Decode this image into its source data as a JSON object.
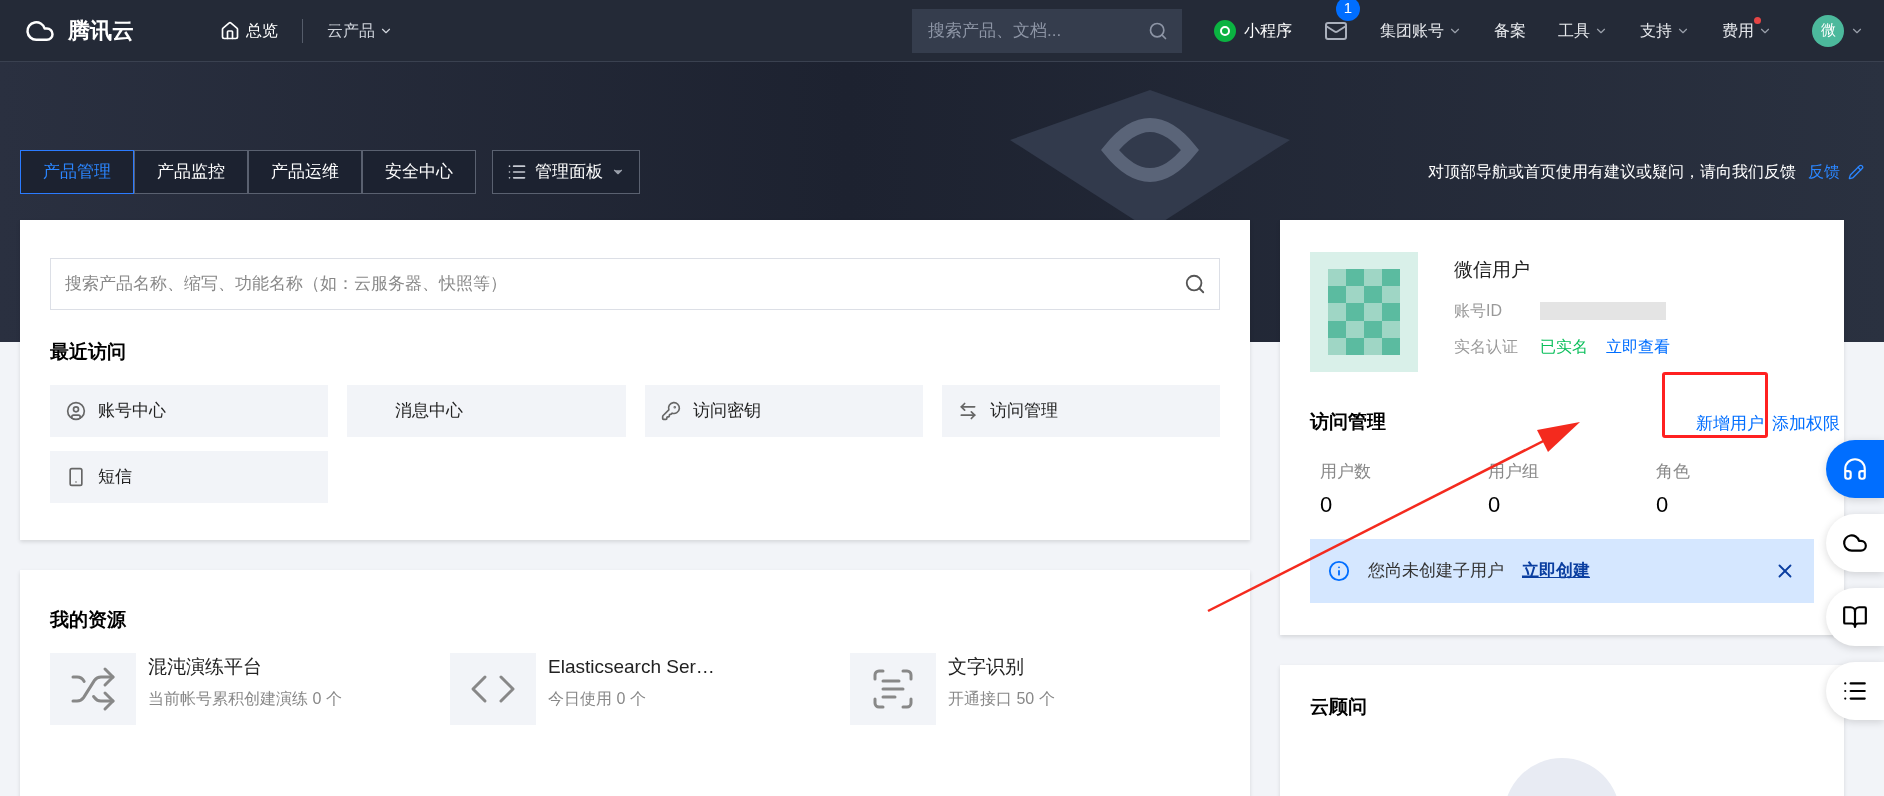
{
  "nav": {
    "logo": "腾讯云",
    "home": "总览",
    "products": "云产品",
    "search_placeholder": "搜索产品、文档...",
    "miniapp": "小程序",
    "mail_badge": "1",
    "items": [
      {
        "label": "集团账号",
        "dropdown": true,
        "dot": false
      },
      {
        "label": "备案",
        "dropdown": false,
        "dot": false
      },
      {
        "label": "工具",
        "dropdown": true,
        "dot": false
      },
      {
        "label": "支持",
        "dropdown": true,
        "dot": false
      },
      {
        "label": "费用",
        "dropdown": true,
        "dot": true
      }
    ],
    "avatar": "微"
  },
  "tabs": [
    {
      "label": "产品管理",
      "selected": true
    },
    {
      "label": "产品监控",
      "selected": false
    },
    {
      "label": "产品运维",
      "selected": false
    },
    {
      "label": "安全中心",
      "selected": false
    }
  ],
  "panel_button": "管理面板",
  "feedback": {
    "text": "对顶部导航或首页使用有建议或疑问，请向我们反馈",
    "link": "反馈"
  },
  "search": {
    "placeholder": "搜索产品名称、缩写、功能名称（如：云服务器、快照等）"
  },
  "recent": {
    "title": "最近访问",
    "items": [
      {
        "label": "账号中心",
        "kind": "user"
      },
      {
        "label": "消息中心",
        "kind": "plain"
      },
      {
        "label": "访问密钥",
        "kind": "key"
      },
      {
        "label": "访问管理",
        "kind": "exchange"
      },
      {
        "label": "短信",
        "kind": "device"
      }
    ]
  },
  "resources": {
    "title": "我的资源",
    "items": [
      {
        "name": "混沌演练平台",
        "desc": "当前帐号累积创建演练 0 个",
        "kind": "shuffle"
      },
      {
        "name": "Elasticsearch Ser…",
        "desc": "今日使用 0 个",
        "kind": "bracket"
      },
      {
        "name": "文字识别",
        "desc": "开通接口 50 个",
        "kind": "text"
      }
    ]
  },
  "profile": {
    "name": "微信用户",
    "id_label": "账号ID",
    "verify_label": "实名认证",
    "verify_status": "已实名",
    "verify_link": "立即查看"
  },
  "access": {
    "title": "访问管理",
    "links": [
      "新增用户",
      "添加权限"
    ],
    "stats": [
      {
        "label": "用户数",
        "value": "0"
      },
      {
        "label": "用户组",
        "value": "0"
      },
      {
        "label": "角色",
        "value": "0"
      }
    ],
    "alert": {
      "text": "您尚未创建子用户",
      "link": "立即创建"
    }
  },
  "advisor": {
    "title": "云顾问"
  },
  "float_buttons": [
    {
      "kind": "headset",
      "selected": true
    },
    {
      "kind": "cloud",
      "selected": false
    },
    {
      "kind": "book",
      "selected": false
    },
    {
      "kind": "list",
      "selected": false
    }
  ]
}
